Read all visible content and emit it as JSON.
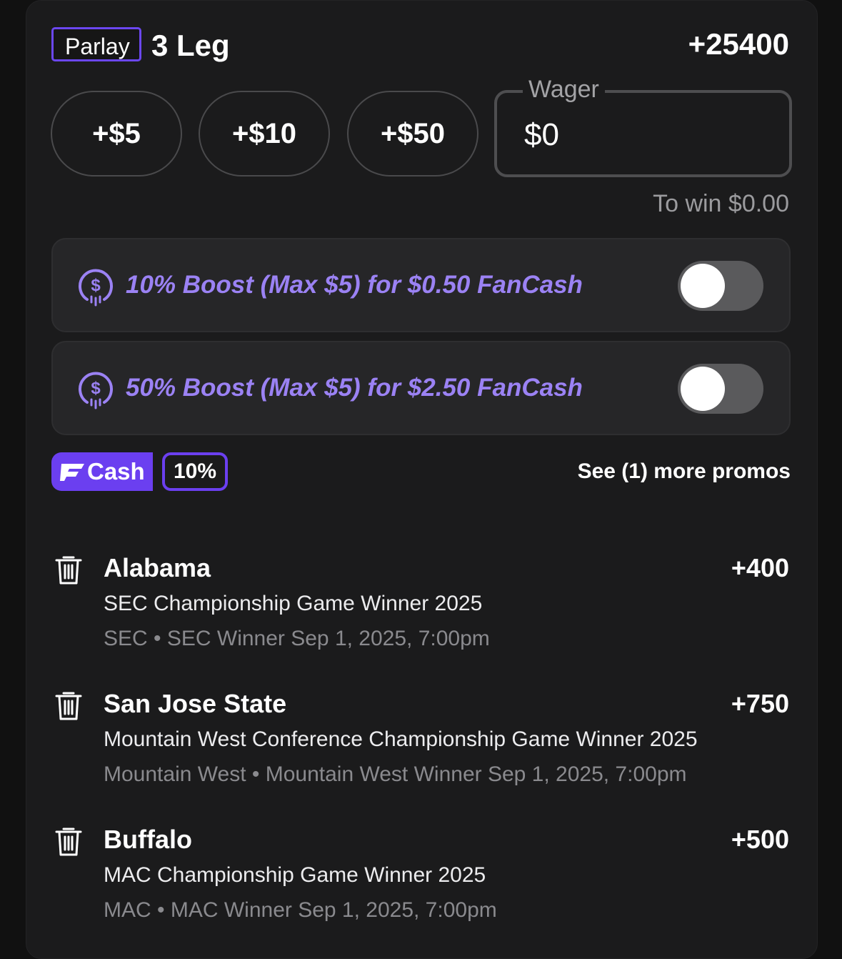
{
  "header": {
    "badge": "Parlay",
    "title": "3 Leg",
    "odds": "+25400"
  },
  "quick_amounts": [
    "+$5",
    "+$10",
    "+$50"
  ],
  "wager": {
    "label": "Wager",
    "value": "$0",
    "to_win": "To win $0.00"
  },
  "boosts": [
    {
      "text": "10% Boost (Max $5) for $0.50 FanCash",
      "icon": "fancash-coin-icon",
      "enabled": false
    },
    {
      "text": "50% Boost (Max $5) for $2.50 FanCash",
      "icon": "fancash-coin-icon",
      "enabled": false
    }
  ],
  "fancash": {
    "logo_text": "Cash",
    "percent": "10%",
    "more_promos": "See (1) more promos"
  },
  "legs": [
    {
      "team": "Alabama",
      "odds": "+400",
      "market": "SEC Championship Game Winner 2025",
      "meta": "SEC • SEC Winner Sep 1, 2025, 7:00pm"
    },
    {
      "team": "San Jose State",
      "odds": "+750",
      "market": "Mountain West Conference Championship Game Winner 2025",
      "meta": "Mountain West • Mountain West Winner Sep 1, 2025, 7:00pm"
    },
    {
      "team": "Buffalo",
      "odds": "+500",
      "market": "MAC Championship Game Winner 2025",
      "meta": "MAC • MAC Winner Sep 1, 2025, 7:00pm"
    }
  ],
  "colors": {
    "accent": "#6b3ff0",
    "boost_text": "#9b82f4",
    "card": "#1b1b1c",
    "background": "#111111"
  }
}
